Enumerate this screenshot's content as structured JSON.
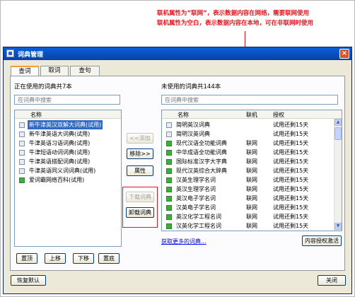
{
  "annotation": {
    "line1": "联机属性为“联网”，表示数据内容在网络，需要联网使用",
    "line2": "联机属性为空白，表示数据内容在本地，可在非联网时使用",
    "color": "#e8141c"
  },
  "window": {
    "title": "词典管理",
    "close_icon": "close-icon"
  },
  "tabs": [
    {
      "label": "查词"
    },
    {
      "label": "取词"
    },
    {
      "label": "查句"
    }
  ],
  "left": {
    "heading": "正在使用的词典共7本",
    "search_placeholder": "在词典中搜索",
    "column_name": "名称",
    "items": [
      {
        "name": "新牛津英汉双解大词典(试用)",
        "selected": true,
        "icon": "book-icon"
      },
      {
        "name": "新牛津英语大词典(试用)",
        "icon": "book-icon"
      },
      {
        "name": "牛津英语习语词典(试用)",
        "icon": "book-icon"
      },
      {
        "name": "牛津短语动词词典(试用)",
        "icon": "book-icon"
      },
      {
        "name": "牛津英语搭配词典(试用)",
        "icon": "book-icon"
      },
      {
        "name": "牛津英语同义词词典(试用)",
        "icon": "book-icon"
      },
      {
        "name": "爱词霸网络百科(试用)",
        "icon": "online-book-icon"
      }
    ],
    "buttons": {
      "top": "置顶",
      "up": "上移",
      "down": "下移",
      "bottom": "置底"
    }
  },
  "middle": {
    "add": "<<添加",
    "remove": "移除>>",
    "properties": "属性",
    "download": "下载词典",
    "uninstall": "卸载词典"
  },
  "right": {
    "heading": "未使用的词典共144本",
    "search_placeholder": "在词典中搜索",
    "columns": {
      "name": "名称",
      "online": "联机",
      "license": "授权"
    },
    "rows": [
      {
        "name": "简明英汉词典",
        "online": "",
        "license": "试用还剩15天",
        "icon": "book-icon"
      },
      {
        "name": "简明汉英词典",
        "online": "",
        "license": "试用还剩15天",
        "icon": "book-icon"
      },
      {
        "name": "现代汉语全功能词典",
        "online": "联网",
        "license": "试用还剩15天",
        "icon": "online-book-icon"
      },
      {
        "name": "中华成语全功能词典",
        "online": "联网",
        "license": "试用还剩15天",
        "icon": "online-book-icon"
      },
      {
        "name": "国际标准汉字大字典",
        "online": "联网",
        "license": "试用还剩15天",
        "icon": "online-book-icon"
      },
      {
        "name": "现代汉英综合大辞典",
        "online": "联网",
        "license": "试用还剩15天",
        "icon": "online-book-icon"
      },
      {
        "name": "汉英生理学名词",
        "online": "联网",
        "license": "试用还剩15天",
        "icon": "online-book-icon"
      },
      {
        "name": "英汉生理学名词",
        "online": "联网",
        "license": "试用还剩15天",
        "icon": "online-book-icon"
      },
      {
        "name": "英汉电子学名词",
        "online": "联网",
        "license": "试用还剩15天",
        "icon": "online-book-icon"
      },
      {
        "name": "汉英电子学名词",
        "online": "联网",
        "license": "试用还剩15天",
        "icon": "online-book-icon"
      },
      {
        "name": "英汉化学工程名词",
        "online": "联网",
        "license": "试用还剩15天",
        "icon": "online-book-icon"
      },
      {
        "name": "汉英化学工程名词",
        "online": "联网",
        "license": "试用还剩15天",
        "icon": "online-book-icon"
      }
    ],
    "more_link": "获取更多的词典...",
    "license_button": "内容授权激活"
  },
  "footer": {
    "restore": "恢复默认",
    "close": "关闭"
  }
}
